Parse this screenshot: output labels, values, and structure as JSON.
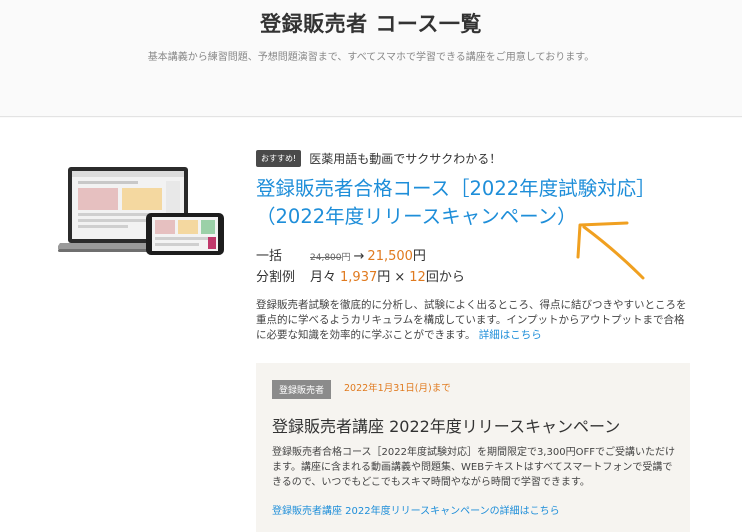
{
  "header": {
    "title": "登録販売者 コース一覧",
    "subtitle": "基本講義から練習問題、予想問題演習まで、すべてスマホで学習できる講座をご用意しております。"
  },
  "course": {
    "image_icon": "device-mockup",
    "badge": "おすすめ!",
    "tagline": "医薬用語も動画でサクサクわかる！",
    "title": "登録販売者合格コース［2022年度試験対応］（2022年度リリースキャンペーン）",
    "price": {
      "lump_label": "一括",
      "old_price": "24,800",
      "old_yen": "円",
      "arrow": "→",
      "new_price": "21,500",
      "new_yen": "円",
      "split_label": "分割例",
      "monthly_prefix": "月々",
      "monthly_amount": "1,937",
      "monthly_yen": "円 ×",
      "months": "12",
      "months_suffix": "回から"
    },
    "description": "登録販売者試験を徹底的に分析し、試験によく出るところ、得点に結びつきやすいところを重点的に学べるようカリキュラムを構成しています。インプットからアウトプットまで合格に必要な知識を効率的に学ぶことができます。",
    "detail_link": "詳細はこちら"
  },
  "campaign": {
    "badge": "登録販売者",
    "date": "2022年1月31日(月)まで",
    "title": "登録販売者講座 2022年度リリースキャンペーン",
    "text": "登録販売者合格コース［2022年度試験対応］を期間限定で3,300円OFFでご受講いただけます。講座に含まれる動画講義や問題集、WEBテキストはすべてスマートフォンで受講できるので、いつでもどこでもスキマ時間やながら時間で学習できます。",
    "link": "登録販売者講座 2022年度リリースキャンペーンの詳細はこちら"
  },
  "colors": {
    "link_blue": "#1e8ed9",
    "price_orange": "#e07a1f",
    "annotation_orange": "#f0a020"
  }
}
